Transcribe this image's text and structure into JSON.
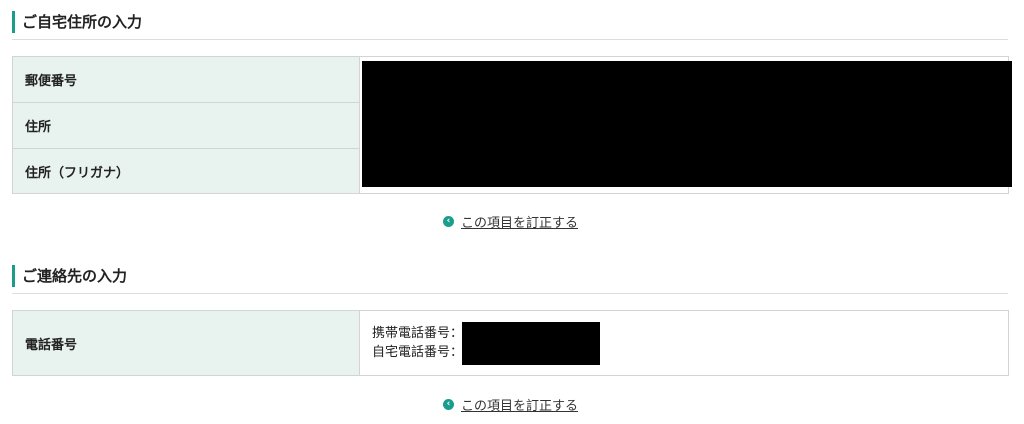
{
  "address_section": {
    "heading": "ご自宅住所の入力",
    "rows": [
      {
        "label": "郵便番号"
      },
      {
        "label": "住所"
      },
      {
        "label": "住所（フリガナ）"
      }
    ],
    "correct_link": "この項目を訂正する"
  },
  "contact_section": {
    "heading": "ご連絡先の入力",
    "phone_label": "電話番号",
    "mobile_label": "携帯電話番号：",
    "home_label": "自宅電話番号：",
    "correct_link": "この項目を訂正する"
  },
  "colors": {
    "accent": "#1a9d8c",
    "label_bg": "#e8f2ee",
    "redaction": "#000000"
  },
  "icons": {
    "correct_link_icon": "chevron-left-circle-icon"
  }
}
